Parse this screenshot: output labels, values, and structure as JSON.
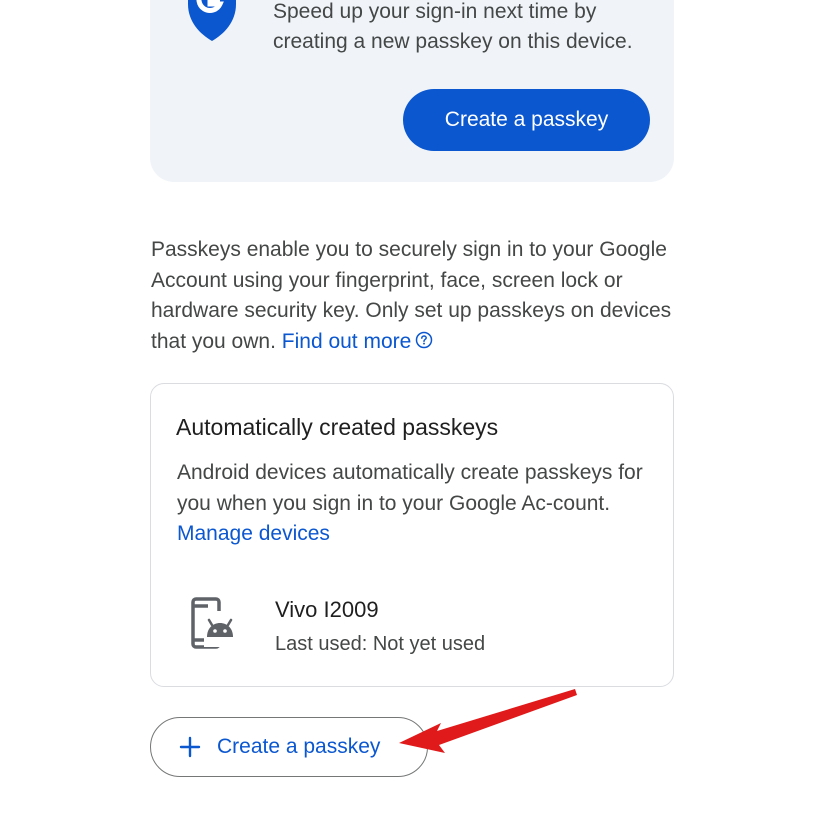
{
  "promo": {
    "text": "Speed up your sign-in next time by creating a new passkey on this device.",
    "button_label": "Create a passkey",
    "shield_letter": "G"
  },
  "description": {
    "text": "Passkeys enable you to securely sign in to your Google Account using your fingerprint, face, screen lock or hardware security key. Only set up passkeys on devices that you own.",
    "link_label": "Find out more"
  },
  "auto_card": {
    "title": "Automatically created passkeys",
    "text": "Android devices automatically create passkeys for you when you sign in to your Google Ac-count.",
    "link_label": "Manage devices",
    "device": {
      "name": "Vivo I2009",
      "last_used": "Last used: Not yet used",
      "icon": "android-phone-icon"
    }
  },
  "create_button": {
    "label": "Create a passkey",
    "icon": "plus-icon"
  },
  "colors": {
    "accent": "#0b57d0",
    "promo_bg": "#f0f4f9",
    "annotation_arrow": "#e01a1a"
  }
}
